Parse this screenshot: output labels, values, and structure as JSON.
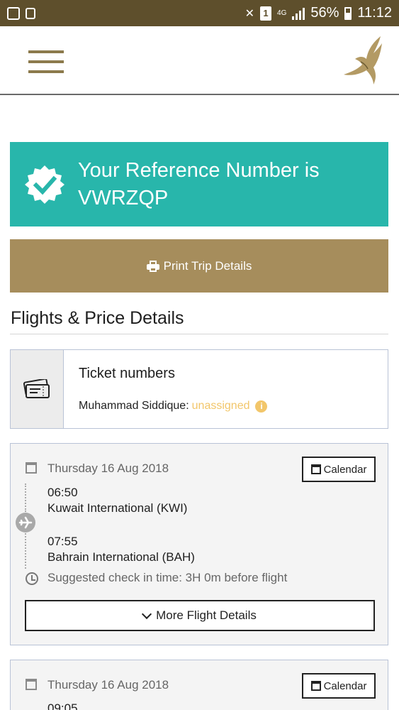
{
  "status_bar": {
    "battery": "56%",
    "time": "11:12",
    "network": "4G",
    "sim": "1",
    "icons": [
      "flipboard-icon",
      "app-icon",
      "mute-icon",
      "sim-icon",
      "signal-icon",
      "battery-icon"
    ]
  },
  "header": {
    "menu_icon": "hamburger-icon",
    "logo": "falcon-logo"
  },
  "reference": {
    "label": "Your Reference Number is",
    "code": "VWRZQP",
    "icon": "check-badge-icon",
    "color": "#28b6ab"
  },
  "print": {
    "label": "Print Trip Details",
    "icon": "print-icon",
    "color": "#a68d5c"
  },
  "section": {
    "title": "Flights & Price Details"
  },
  "ticket": {
    "title": "Ticket numbers",
    "passenger": "Muhammad Siddique:",
    "status": "unassigned",
    "icon": "ticket-icon"
  },
  "flights": [
    {
      "date": "Thursday 16 Aug 2018",
      "calendar_label": "Calendar",
      "depart_time": "06:50",
      "depart_airport": "Kuwait International (KWI)",
      "arrive_time": "07:55",
      "arrive_airport": "Bahrain International (BAH)",
      "checkin": "Suggested check in time: 3H 0m before flight",
      "more_label": "More Flight Details"
    },
    {
      "date": "Thursday 16 Aug 2018",
      "calendar_label": "Calendar",
      "depart_time": "09:05"
    }
  ]
}
